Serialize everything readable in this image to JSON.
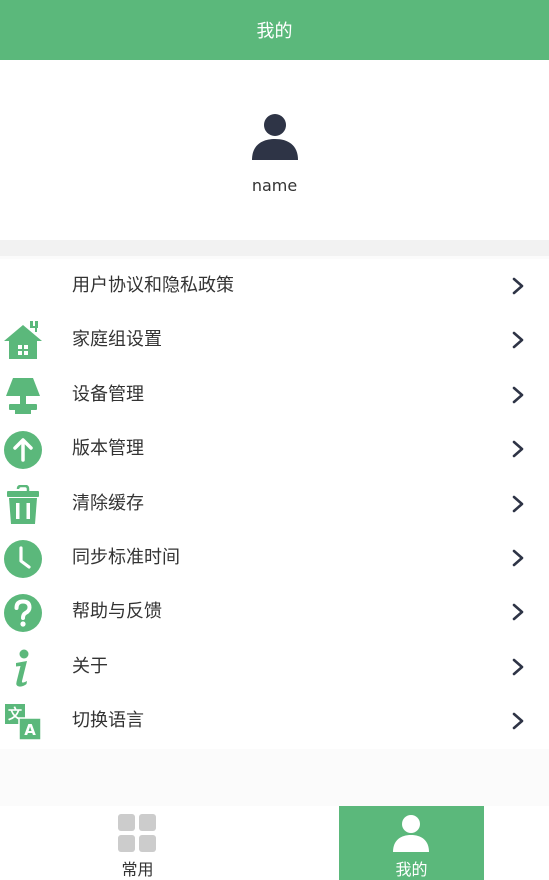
{
  "header": {
    "title": "我的"
  },
  "profile": {
    "name": "name",
    "avatar_icon": "user-icon"
  },
  "menu": [
    {
      "label": "用户协议和隐私政策",
      "icon": "",
      "name": "menu-item-user-agreement"
    },
    {
      "label": "家庭组设置",
      "icon": "house-icon",
      "name": "menu-item-family-group"
    },
    {
      "label": "设备管理",
      "icon": "lamp-icon",
      "name": "menu-item-device-management"
    },
    {
      "label": "版本管理",
      "icon": "arrow-up-icon",
      "name": "menu-item-version"
    },
    {
      "label": "清除缓存",
      "icon": "trash-icon",
      "name": "menu-item-clear-cache"
    },
    {
      "label": "同步标准时间",
      "icon": "clock-icon",
      "name": "menu-item-sync-time"
    },
    {
      "label": "帮助与反馈",
      "icon": "question-icon",
      "name": "menu-item-help"
    },
    {
      "label": "关于",
      "icon": "info-icon",
      "name": "menu-item-about"
    },
    {
      "label": "切换语言",
      "icon": "translate-icon",
      "name": "menu-item-language"
    }
  ],
  "tabs": [
    {
      "label": "常用",
      "icon": "grid-icon",
      "active": false
    },
    {
      "label": "我的",
      "icon": "user-icon",
      "active": true
    }
  ],
  "colors": {
    "accent": "#5bb87b",
    "text": "#333333",
    "icon_dark": "#2e3446",
    "inactive_icon": "#cccccc"
  }
}
